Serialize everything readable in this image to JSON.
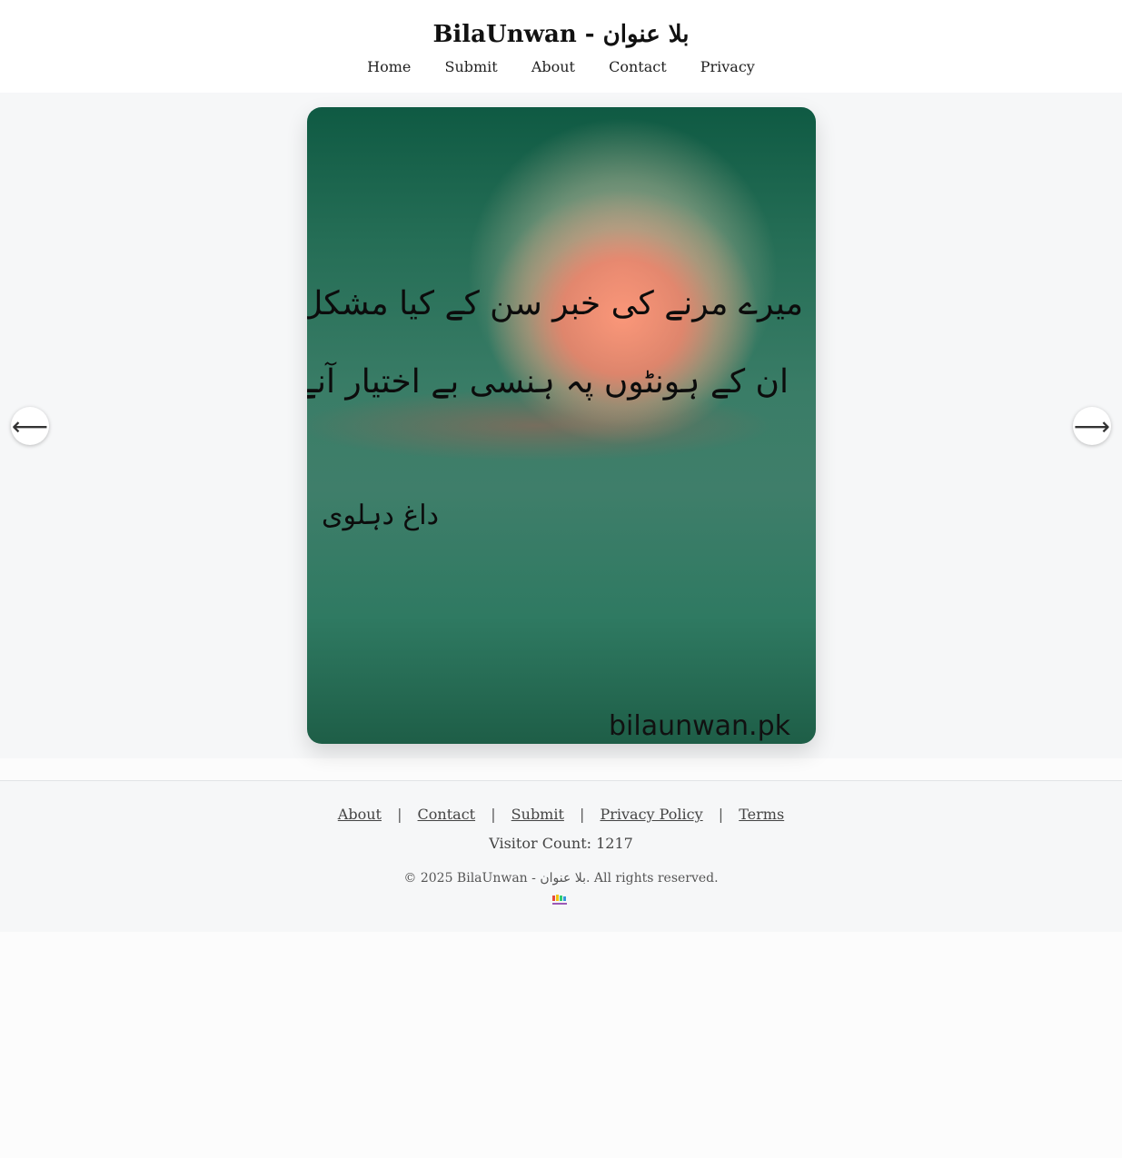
{
  "header": {
    "site_title": "BilaUnwan - بلا عنوان",
    "nav": {
      "home": "Home",
      "submit": "Submit",
      "about": "About",
      "contact": "Contact",
      "privacy": "Privacy"
    }
  },
  "slide": {
    "poem_line_1": "میرے مرنے کی خبر سن کے کیا مشکل سے ضبط",
    "poem_line_2": "ان کے ہونٹوں پہ ہنسی بے اختیار آنے کی تھی",
    "poet": "داغ دہلوی",
    "watermark": "bilaunwan.pk",
    "prev_arrow": "⟵",
    "next_arrow": "⟶"
  },
  "footer": {
    "links": {
      "about": "About",
      "contact": "Contact",
      "submit": "Submit",
      "privacy_policy": "Privacy Policy",
      "terms": "Terms"
    },
    "separator": "|",
    "visitor_count": "Visitor Count: 1217",
    "copyright": "© 2025 BilaUnwan - بلا عنوان. All rights reserved."
  }
}
